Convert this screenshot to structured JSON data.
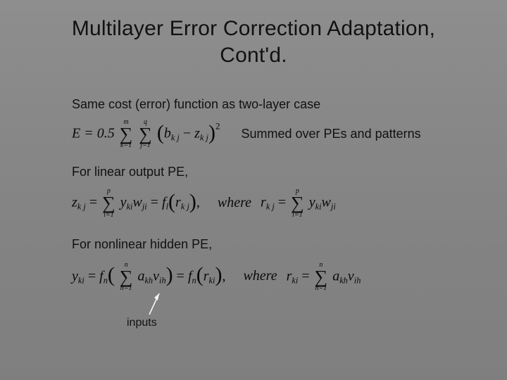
{
  "title_line1": "Multilayer Error Correction Adaptation,",
  "title_line2": "Cont'd.",
  "line_cost": "Same cost (error) function as two-layer case",
  "eq1": {
    "lhs": "E = 0.5",
    "sum1_top": "m",
    "sum1_bot": "k=1",
    "sum2_top": "q",
    "sum2_bot": "j=1",
    "term_open": "(",
    "term_b": "b",
    "term_b_sub": "k j",
    "minus": " − ",
    "term_z": "z",
    "term_z_sub": "k j",
    "term_close": ")",
    "sq": "2"
  },
  "eq1_note": "Summed over PEs and patterns",
  "line_linear": "For linear output PE,",
  "eq2": {
    "z": "z",
    "z_sub": "k j",
    "eq": " = ",
    "sum_top": "p",
    "sum_bot": "i=1",
    "y": "y",
    "y_sub": "ki",
    "w": "w",
    "w_sub": "ji",
    "eq2": " = ",
    "f": "f",
    "f_sub": "l",
    "popen": "(",
    "r": "r",
    "r_sub": "k j",
    "pclose": ")",
    "comma": ",",
    "where": "where ",
    "r2": "r",
    "r2_sub": "k j",
    "eq3": " = ",
    "sum2_top": "p",
    "sum2_bot": "i=1",
    "y2": "y",
    "y2_sub": "ki",
    "w2": "w",
    "w2_sub": "ji"
  },
  "line_nonlinear": "For nonlinear hidden PE,",
  "eq3": {
    "y": "y",
    "y_sub": "ki",
    "eq": " = ",
    "fn": "f",
    "fn_sub": "n",
    "popen": "(",
    "sum_top": "n",
    "sum_bot": "h=1",
    "a": "a",
    "a_sub": "kh",
    "v": "v",
    "v_sub": "ih",
    "pclose": ")",
    "eq2": " = ",
    "fn2": "f",
    "fn2_sub": "n",
    "popen2": "(",
    "r": "r",
    "r_sub": "ki",
    "pclose2": ")",
    "comma": ",",
    "where": "where ",
    "r2": "r",
    "r2_sub": "ki",
    "eq3": " = ",
    "sum2_top": "n",
    "sum2_bot": "h=1",
    "a2": "a",
    "a2_sub": "kh",
    "v2": "v",
    "v2_sub": "ih"
  },
  "inputs_label": "inputs"
}
